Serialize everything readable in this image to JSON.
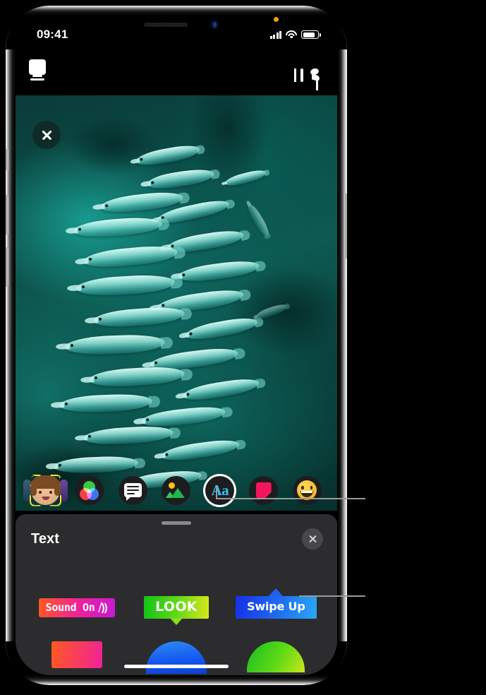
{
  "status_bar": {
    "time": "09:41",
    "mic_indicator": "orange-dot",
    "cellular": "4-bars",
    "wifi": "wifi-icon",
    "battery": "battery-icon"
  },
  "top_toolbar": {
    "left_button": {
      "name": "cards-icon",
      "label": "Cards"
    },
    "right_buttons": [
      {
        "name": "layout-icon",
        "label": "Layout"
      },
      {
        "name": "music-icon",
        "label": "Music"
      }
    ]
  },
  "photo": {
    "close_label": "Close",
    "description": "School of silver fish underwater"
  },
  "effects_bar": {
    "items": [
      {
        "name": "memoji-icon",
        "label": "Memoji",
        "selected": false
      },
      {
        "name": "filters-icon",
        "label": "Filters",
        "selected": false
      },
      {
        "name": "text-bubble-icon",
        "label": "Text Bubble",
        "selected": false
      },
      {
        "name": "photo-icon",
        "label": "Photos",
        "selected": false
      },
      {
        "name": "text-aa-icon",
        "label": "Aa",
        "selected": true
      },
      {
        "name": "sticker-icon",
        "label": "Stickers",
        "selected": false
      },
      {
        "name": "emoji-icon",
        "label": "Emoji",
        "selected": false
      }
    ]
  },
  "text_panel": {
    "title": "Text",
    "close_label": "Close",
    "handle_label": "Drag handle",
    "styles_row1": [
      {
        "name": "style-sound-on",
        "label": "Sound On",
        "suffix": "⧸))",
        "colors": [
          "#ff5a1f",
          "#f0219a",
          "#c41bd6"
        ]
      },
      {
        "name": "style-look",
        "label": "LOOK",
        "colors": [
          "#14c21a",
          "#d9e81c"
        ]
      },
      {
        "name": "style-swipe-up",
        "label": "Swipe Up",
        "colors": [
          "#1630e8",
          "#28a8f5"
        ]
      }
    ],
    "styles_row2": [
      {
        "name": "style-pink-bar",
        "label": "",
        "colors": [
          "#ff5a1f",
          "#f0219a"
        ]
      },
      {
        "name": "style-blue-dome",
        "label": "",
        "colors": [
          "#2f8bf5",
          "#0f3fd6"
        ]
      },
      {
        "name": "style-green-dome",
        "label": "",
        "colors": [
          "#16bd22",
          "#c9e61c"
        ]
      }
    ]
  },
  "callouts": [
    {
      "name": "callout-text-effect-button",
      "target": "text-aa-icon"
    },
    {
      "name": "callout-text-style-swipe-up",
      "target": "style-swipe-up"
    }
  ],
  "home_indicator": {
    "name": "home-indicator"
  }
}
